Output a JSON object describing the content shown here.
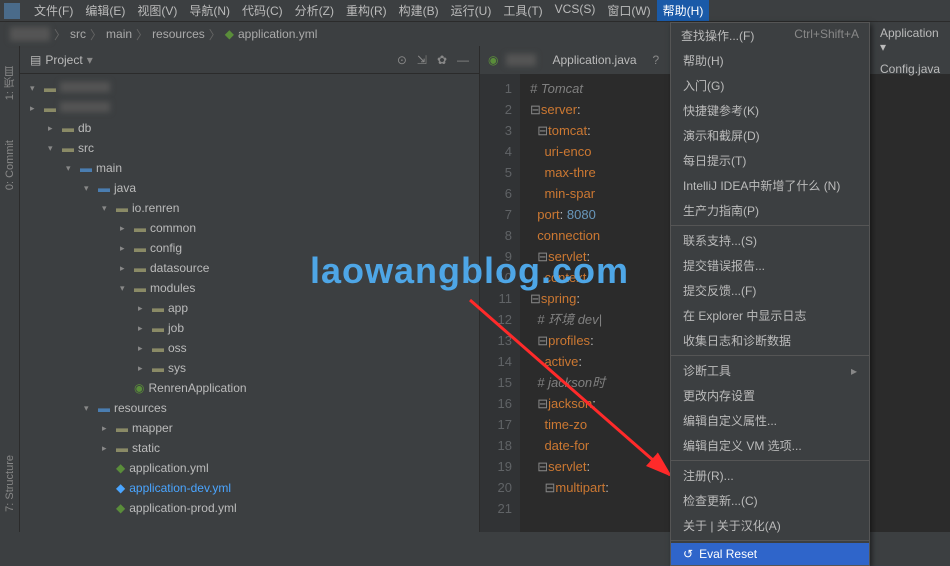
{
  "menubar": {
    "items": [
      "文件(F)",
      "编辑(E)",
      "视图(V)",
      "导航(N)",
      "代码(C)",
      "分析(Z)",
      "重构(R)",
      "构建(B)",
      "运行(U)",
      "工具(T)",
      "VCS(S)",
      "窗口(W)",
      "帮助(H)"
    ]
  },
  "breadcrumb": {
    "parts": [
      "src",
      "main",
      "resources",
      "application.yml"
    ]
  },
  "left_rail": {
    "items": [
      "1: 项目",
      "0: Commit",
      "7: Structure"
    ]
  },
  "project": {
    "title": "Project",
    "tree": [
      {
        "indent": 0,
        "chev": "▾",
        "icon": "folder",
        "label": ""
      },
      {
        "indent": 0,
        "chev": "▸",
        "icon": "folder",
        "label": ""
      },
      {
        "indent": 1,
        "chev": "▸",
        "icon": "folder",
        "label": "db"
      },
      {
        "indent": 1,
        "chev": "▾",
        "icon": "folder",
        "label": "src"
      },
      {
        "indent": 2,
        "chev": "▾",
        "icon": "folder-src",
        "label": "main"
      },
      {
        "indent": 3,
        "chev": "▾",
        "icon": "folder-src",
        "label": "java"
      },
      {
        "indent": 4,
        "chev": "▾",
        "icon": "folder",
        "label": "io.renren"
      },
      {
        "indent": 5,
        "chev": "▸",
        "icon": "folder",
        "label": "common"
      },
      {
        "indent": 5,
        "chev": "▸",
        "icon": "folder",
        "label": "config"
      },
      {
        "indent": 5,
        "chev": "▸",
        "icon": "folder",
        "label": "datasource"
      },
      {
        "indent": 5,
        "chev": "▾",
        "icon": "folder",
        "label": "modules"
      },
      {
        "indent": 6,
        "chev": "▸",
        "icon": "folder",
        "label": "app"
      },
      {
        "indent": 6,
        "chev": "▸",
        "icon": "folder",
        "label": "job"
      },
      {
        "indent": 6,
        "chev": "▸",
        "icon": "folder",
        "label": "oss"
      },
      {
        "indent": 6,
        "chev": "▸",
        "icon": "folder",
        "label": "sys"
      },
      {
        "indent": 5,
        "chev": " ",
        "icon": "class",
        "label": "RenrenApplication"
      },
      {
        "indent": 3,
        "chev": "▾",
        "icon": "folder-src",
        "label": "resources"
      },
      {
        "indent": 4,
        "chev": "▸",
        "icon": "folder",
        "label": "mapper"
      },
      {
        "indent": 4,
        "chev": "▸",
        "icon": "folder",
        "label": "static"
      },
      {
        "indent": 4,
        "chev": " ",
        "icon": "yml",
        "label": "application.yml"
      },
      {
        "indent": 4,
        "chev": " ",
        "icon": "yml-sel",
        "label": "application-dev.yml"
      },
      {
        "indent": 4,
        "chev": " ",
        "icon": "yml",
        "label": "application-prod.yml"
      }
    ]
  },
  "editor": {
    "tab1": "Application.java",
    "tab2": "Application ▾",
    "tab3": "Config.java",
    "lines": [
      {
        "n": 1,
        "html": "<span class='com'># Tomcat</span>"
      },
      {
        "n": 2,
        "html": "<span class='fold'>⊟</span><span class='kw'>server</span>:"
      },
      {
        "n": 3,
        "html": "  <span class='fold'>⊟</span><span class='kw'>tomcat</span>:"
      },
      {
        "n": 4,
        "html": "    <span class='kw'>uri-enco</span>"
      },
      {
        "n": 5,
        "html": "    <span class='kw'>max-thre</span>"
      },
      {
        "n": 6,
        "html": "    <span class='kw'>min-spar</span>"
      },
      {
        "n": 7,
        "html": "  <span class='kw'>port</span>: <span class='num'>8080</span>"
      },
      {
        "n": 8,
        "html": "  <span class='kw'>connection</span>"
      },
      {
        "n": 9,
        "html": "  <span class='fold'>⊟</span><span class='kw'>servlet</span>:"
      },
      {
        "n": 10,
        "html": "    <span class='kw'>context-</span>"
      },
      {
        "n": 11,
        "html": ""
      },
      {
        "n": 12,
        "html": "<span class='fold'>⊟</span><span class='kw'>spring</span>:"
      },
      {
        "n": 13,
        "html": "  <span class='com'># 环境 dev|</span>"
      },
      {
        "n": 14,
        "html": "  <span class='fold'>⊟</span><span class='kw'>profiles</span>:"
      },
      {
        "n": 15,
        "html": "    <span class='kw'>active</span>: "
      },
      {
        "n": 16,
        "html": "  <span class='com'># jackson时</span>"
      },
      {
        "n": 17,
        "html": "  <span class='fold'>⊟</span><span class='kw'>jackson</span>:"
      },
      {
        "n": 18,
        "html": "    <span class='kw'>time-zo</span>"
      },
      {
        "n": 19,
        "html": "    <span class='kw'>date-for</span>"
      },
      {
        "n": 20,
        "html": "  <span class='fold'>⊟</span><span class='kw'>servlet</span>:"
      },
      {
        "n": 21,
        "html": "    <span class='fold'>⊟</span><span class='kw'>multipart</span>:"
      }
    ]
  },
  "help": {
    "search": "查找操作...(F)",
    "shortcut": "Ctrl+Shift+A",
    "items": [
      {
        "t": "帮助(H)"
      },
      {
        "t": "入门(G)"
      },
      {
        "t": "快捷键参考(K)"
      },
      {
        "t": "演示和截屏(D)"
      },
      {
        "t": "每日提示(T)"
      },
      {
        "t": "IntelliJ IDEA中新增了什么 (N)"
      },
      {
        "t": "生产力指南(P)"
      },
      {
        "sep": true
      },
      {
        "t": "联系支持...(S)"
      },
      {
        "t": "提交错误报告..."
      },
      {
        "t": "提交反馈...(F)"
      },
      {
        "t": "在 Explorer 中显示日志"
      },
      {
        "t": "收集日志和诊断数据"
      },
      {
        "sep": true
      },
      {
        "t": "诊断工具",
        "sub": "▸"
      },
      {
        "t": "更改内存设置"
      },
      {
        "t": "编辑自定义属性..."
      },
      {
        "t": "编辑自定义 VM 选项..."
      },
      {
        "sep": true
      },
      {
        "t": "注册(R)..."
      },
      {
        "t": "检查更新...(C)"
      },
      {
        "t": "关于 | 关于汉化(A)"
      },
      {
        "sep": true
      },
      {
        "t": "Eval Reset",
        "hl": true,
        "icon": "↺"
      }
    ]
  },
  "watermark": "laowangblog.com"
}
